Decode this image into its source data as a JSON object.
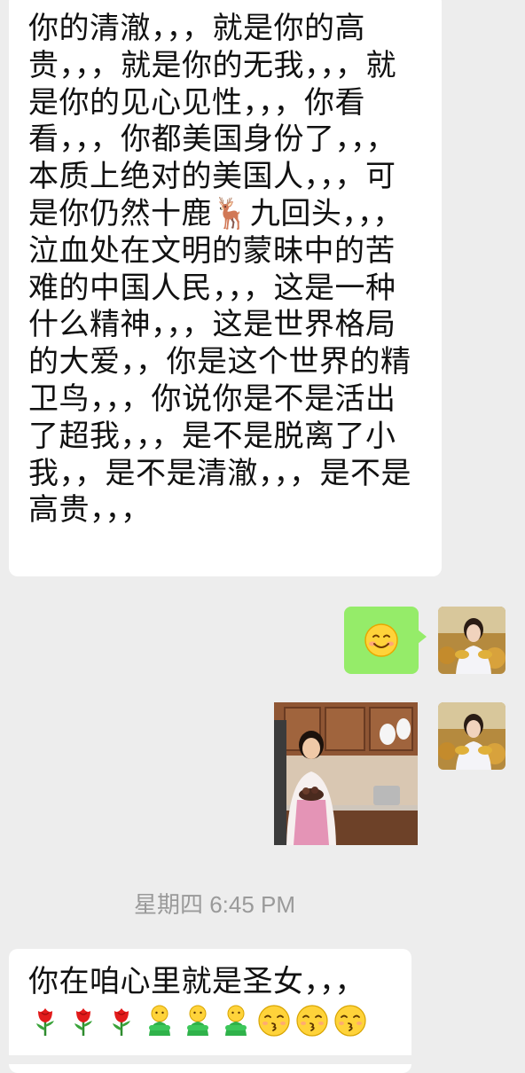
{
  "messages": {
    "incoming_1": {
      "text": "你的清澈，，，就是你的高贵，，，就是你的无我，，，就是你的见心见性，，，你看看，，，你都美国身份了，，，本质上绝对的美国人，，，可是你仍然十鹿🦌九回头，，，泣血处在文明的蒙昧中的苦难的中国人民，，，这是一种什么精神，，，这是世界格局的大爱，，你是这个世界的精卫鸟，，，你说你是不是活出了超我，，，是不是脱离了小我，，是不是清澈，，，是不是高贵，，，"
    },
    "outgoing_1": {
      "emoji": "smiling-face-icon"
    },
    "outgoing_2": {
      "type": "photo"
    },
    "timestamp": "星期四 6:45 PM",
    "incoming_2": {
      "text": "你在咱心里就是圣女，，，",
      "emojis": [
        "rose-icon",
        "rose-icon",
        "rose-icon",
        "person-icon",
        "person-icon",
        "person-icon",
        "kissing-face-icon",
        "kissing-face-icon",
        "kissing-face-icon"
      ]
    }
  },
  "colors": {
    "background": "#ededed",
    "incoming_bubble": "#ffffff",
    "outgoing_bubble": "#95ec69",
    "timestamp": "#9a9a9a"
  }
}
